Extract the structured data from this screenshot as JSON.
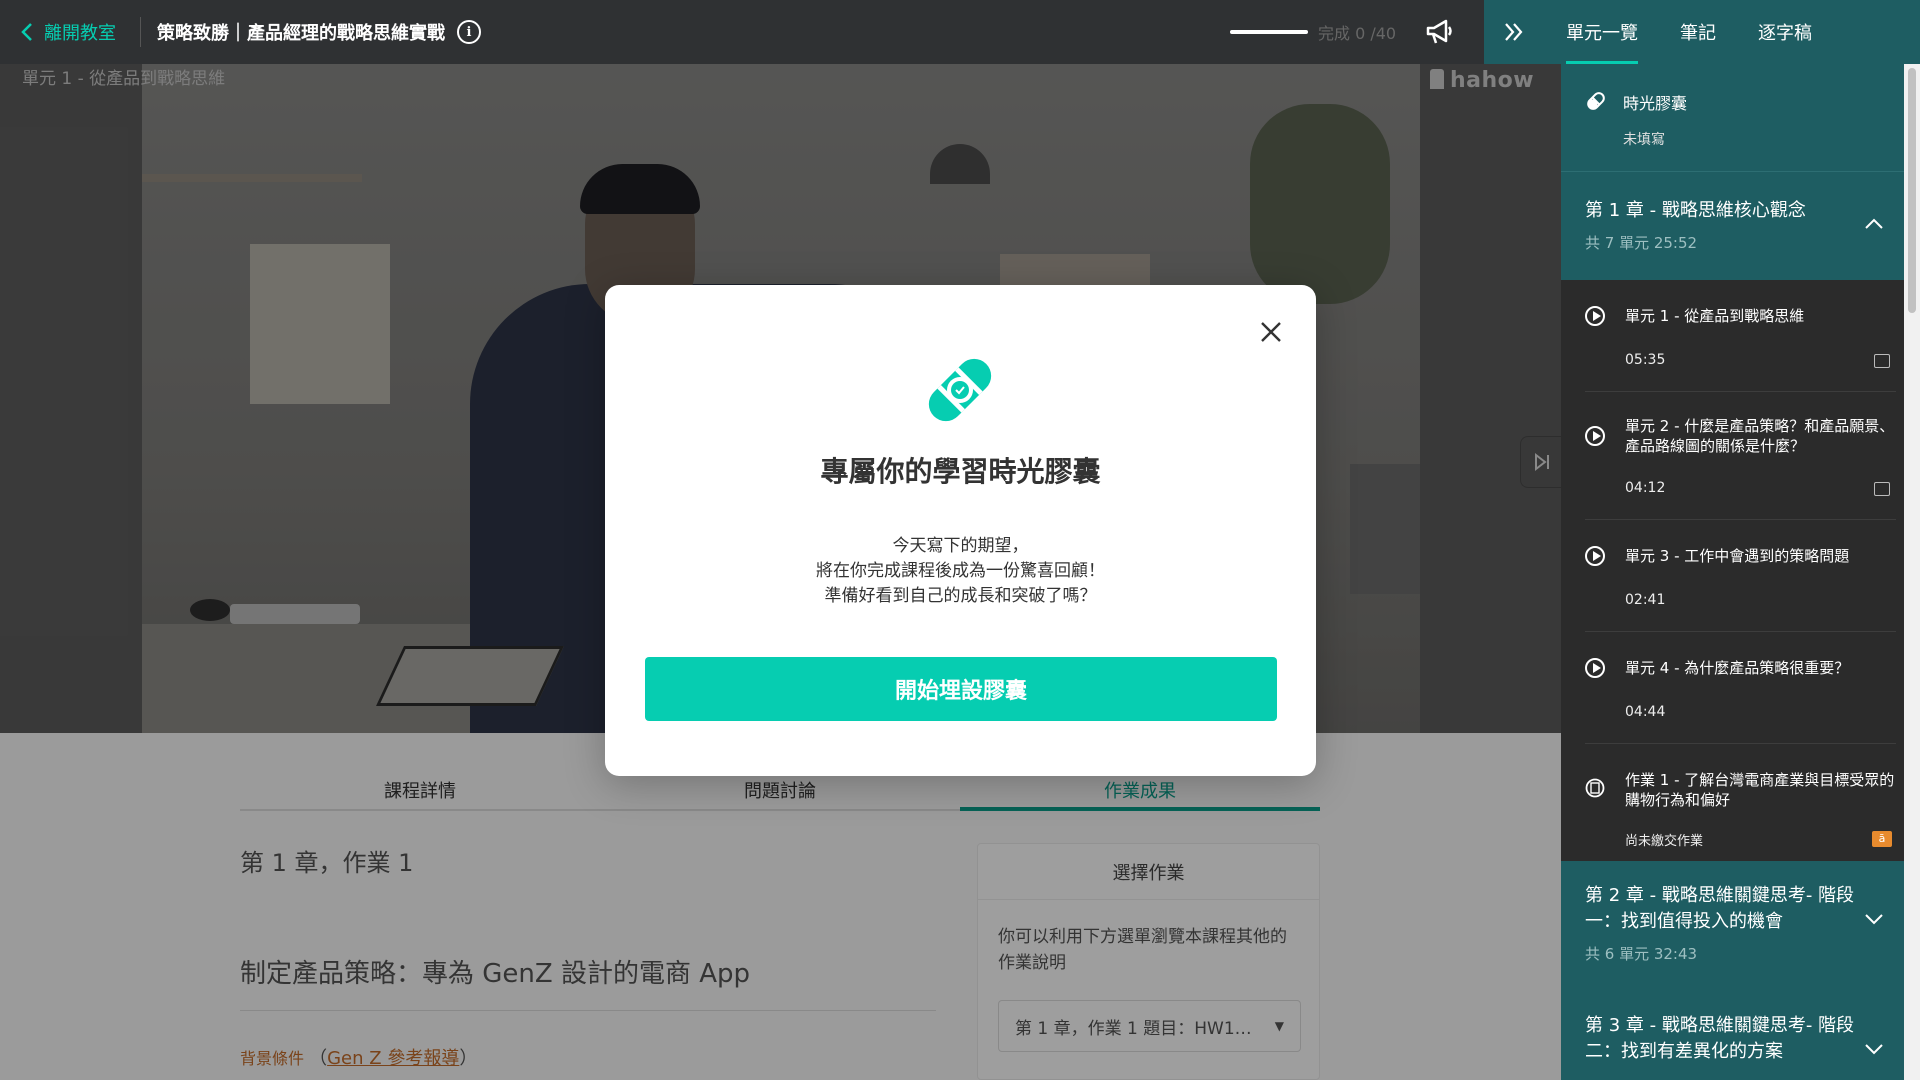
{
  "header": {
    "back_label": "離開教室",
    "course_title": "策略致勝｜產品經理的戰略思維實戰",
    "progress_text": "完成 0 /40",
    "progress_fraction": 0.0
  },
  "right_tabs": [
    "單元一覽",
    "筆記",
    "逐字稿"
  ],
  "video": {
    "unit_label": "單元 1 - 從產品到戰略思維",
    "watermark": "hahow"
  },
  "content": {
    "tabs": [
      "課程詳情",
      "問題討論",
      "作業成果"
    ],
    "homework_title": "第 1 章，作業 1",
    "homework_subtitle": "制定產品策略：專為 GenZ 設計的電商 App",
    "background_label": "背景條件",
    "background_paren_open": "（",
    "background_link": "Gen Z 參考報導",
    "background_paren_close": "）",
    "select_card": {
      "title": "選擇作業",
      "description": "你可以利用下方選單瀏覽本課程其他的作業說明",
      "selected": "第 1 章，作業 1 題目：HW1…"
    }
  },
  "sidebar": {
    "capsule": {
      "title": "時光膠囊",
      "status": "未填寫"
    },
    "chapters": [
      {
        "title": "第 1 章 - 戰略思維核心觀念",
        "meta": "共 7 單元 25:52",
        "expanded": true
      },
      {
        "title": "第 2 章 - 戰略思維關鍵思考- 階段一：找到值得投入的機會",
        "meta": "共 6 單元 32:43",
        "expanded": false
      },
      {
        "title": "第 3 章 - 戰略思維關鍵思考- 階段二：找到有差異化的方案",
        "meta": "",
        "expanded": false
      }
    ],
    "units": [
      {
        "title": "單元 1 - 從產品到戰略思維",
        "time": "05:35"
      },
      {
        "title": "單元 2 - 什麼是產品策略？和產品願景、產品路線圖的關係是什麼？",
        "time": "04:12"
      },
      {
        "title": "單元 3 - 工作中會遇到的策略問題",
        "time": "02:41"
      },
      {
        "title": "單元 4 - 為什麼產品策略很重要？",
        "time": "04:44"
      },
      {
        "title": "作業 1 - 了解台灣電商產業與目標受眾的購物行為和偏好",
        "time": "尚未繳交作業",
        "badge": "ā"
      }
    ]
  },
  "modal": {
    "title": "專屬你的學習時光膠囊",
    "line1": "今天寫下的期望，",
    "line2": "將在你完成課程後成為一份驚喜回顧！",
    "line3": "準備好看到自己的成長和突破了嗎？",
    "button": "開始埋設膠囊"
  },
  "colors": {
    "accent": "#06cdb1",
    "sidebar_bg": "#1e5d62",
    "topbar_bg": "#2f3133"
  }
}
